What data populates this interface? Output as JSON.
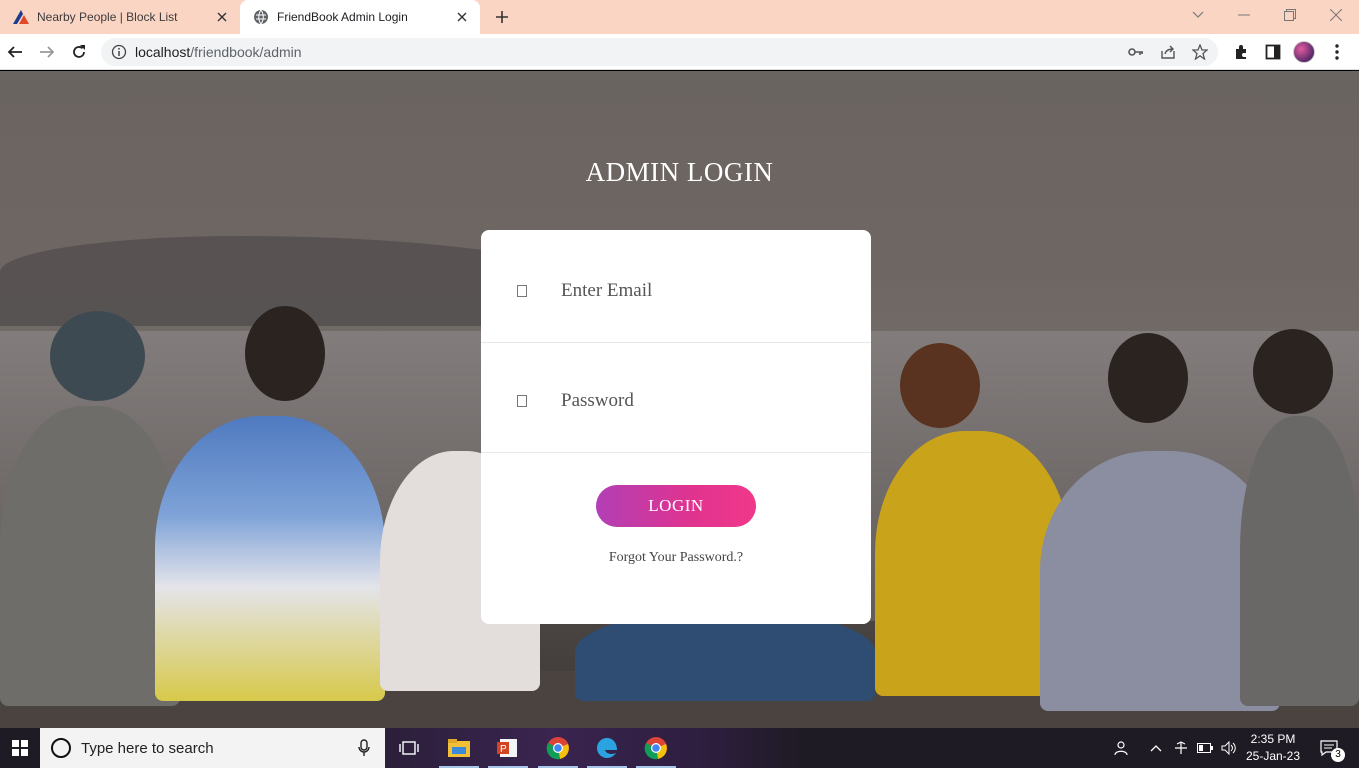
{
  "browser": {
    "tabs": [
      {
        "title": "Nearby People | Block List",
        "active": false
      },
      {
        "title": "FriendBook Admin Login",
        "active": true
      }
    ],
    "url_host": "localhost",
    "url_path": "/friendbook/admin"
  },
  "page": {
    "heading": "ADMIN LOGIN",
    "email_placeholder": "Enter Email",
    "password_placeholder": "Password",
    "login_label": "LOGIN",
    "forgot_label": "Forgot Your Password.?"
  },
  "taskbar": {
    "search_placeholder": "Type here to search",
    "time": "2:35 PM",
    "date": "25-Jan-23",
    "notification_count": "3"
  },
  "colors": {
    "tabbar_bg": "#fbd5c4",
    "login_gradient_start": "#b23fb5",
    "login_gradient_end": "#f0388a"
  }
}
